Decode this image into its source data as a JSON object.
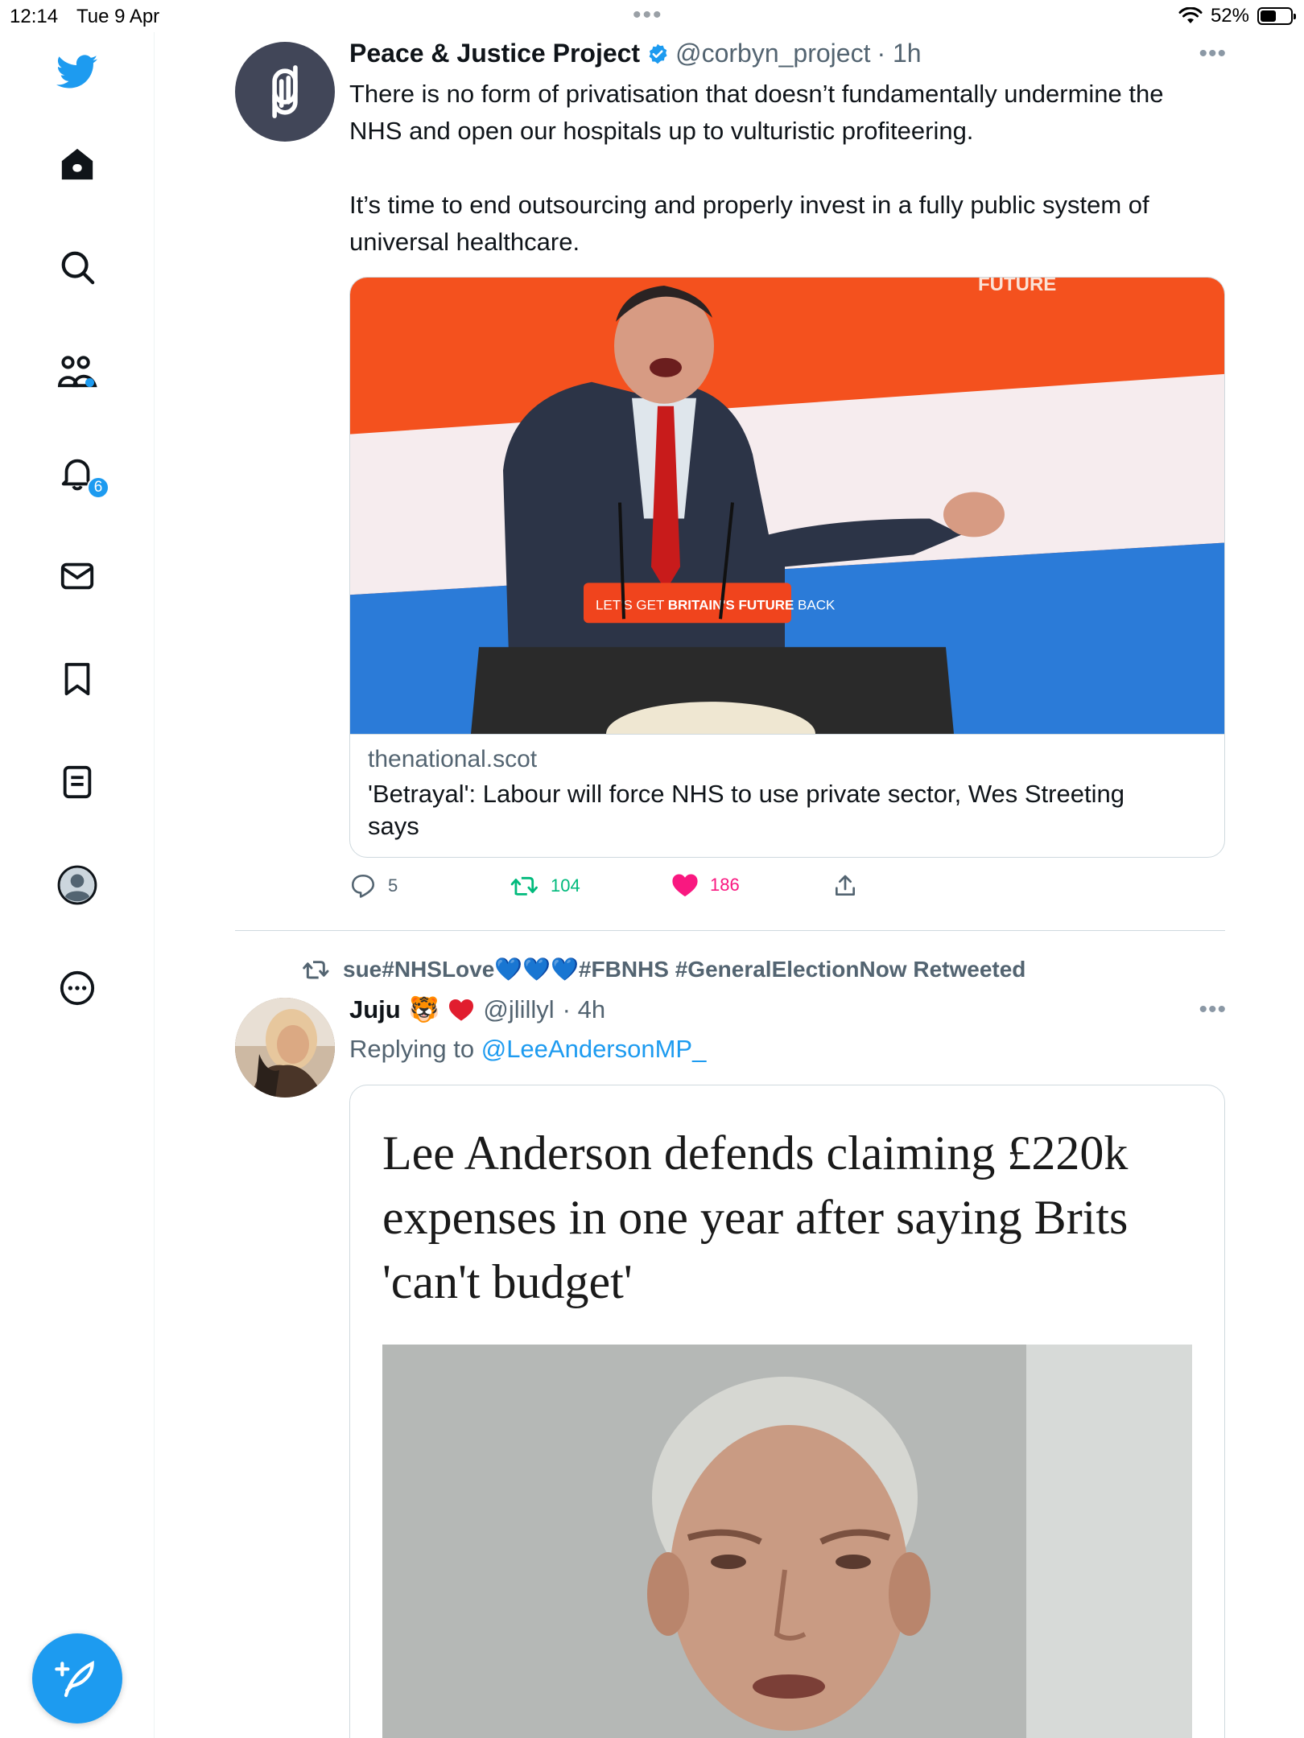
{
  "status_bar": {
    "time": "12:14",
    "date": "Tue 9 Apr",
    "battery": "52%",
    "battery_level": 0.52
  },
  "sidebar": {
    "items": [
      {
        "icon": "twitter-bird-icon"
      },
      {
        "icon": "home-icon"
      },
      {
        "icon": "search-icon"
      },
      {
        "icon": "communities-icon"
      },
      {
        "icon": "notifications-icon",
        "badge": "6"
      },
      {
        "icon": "messages-icon"
      },
      {
        "icon": "bookmarks-icon"
      },
      {
        "icon": "lists-icon"
      },
      {
        "icon": "profile-icon"
      },
      {
        "icon": "more-icon"
      }
    ],
    "compose_icon": "compose-feather-icon"
  },
  "colors": {
    "accent": "#1d9bf0",
    "retweet": "#00ba7c",
    "like": "#f91880",
    "secondary_text": "#536471"
  },
  "tweets": [
    {
      "name": "Peace & Justice Project",
      "verified": true,
      "handle": "@corbyn_project",
      "time": "· 1h",
      "text_1": "There is no form of privatisation that doesn’t fundamentally undermine the NHS and open our hospitals up to vulturistic profiteering.",
      "text_2": "It’s time to end outsourcing and properly invest in a fully public system of universal healthcare.",
      "card": {
        "banner_text": "FUTURE",
        "podium_text_1": "LET'S GET ",
        "podium_text_2": "BRITAIN'S FUTURE",
        "podium_text_3": " BACK",
        "domain": "thenational.scot",
        "title": "'Betrayal': Labour will force NHS to use private sector, Wes Streeting says"
      },
      "replies": "5",
      "retweets": "104",
      "likes": "186"
    },
    {
      "retweeted_by": "sue#NHSLove",
      "retweeted_by_suffix": "#FBNHS #GeneralElectionNow Retweeted",
      "name": "Juju",
      "name_emoji": "🐯",
      "handle": "@jlillyl",
      "time": "· 4h",
      "replying_to_label": "Replying to ",
      "replying_to_handle": "@LeeAndersonMP_",
      "headline": "Lee Anderson defends claiming £220k expenses in one year after saying Brits 'can't budget'"
    }
  ]
}
